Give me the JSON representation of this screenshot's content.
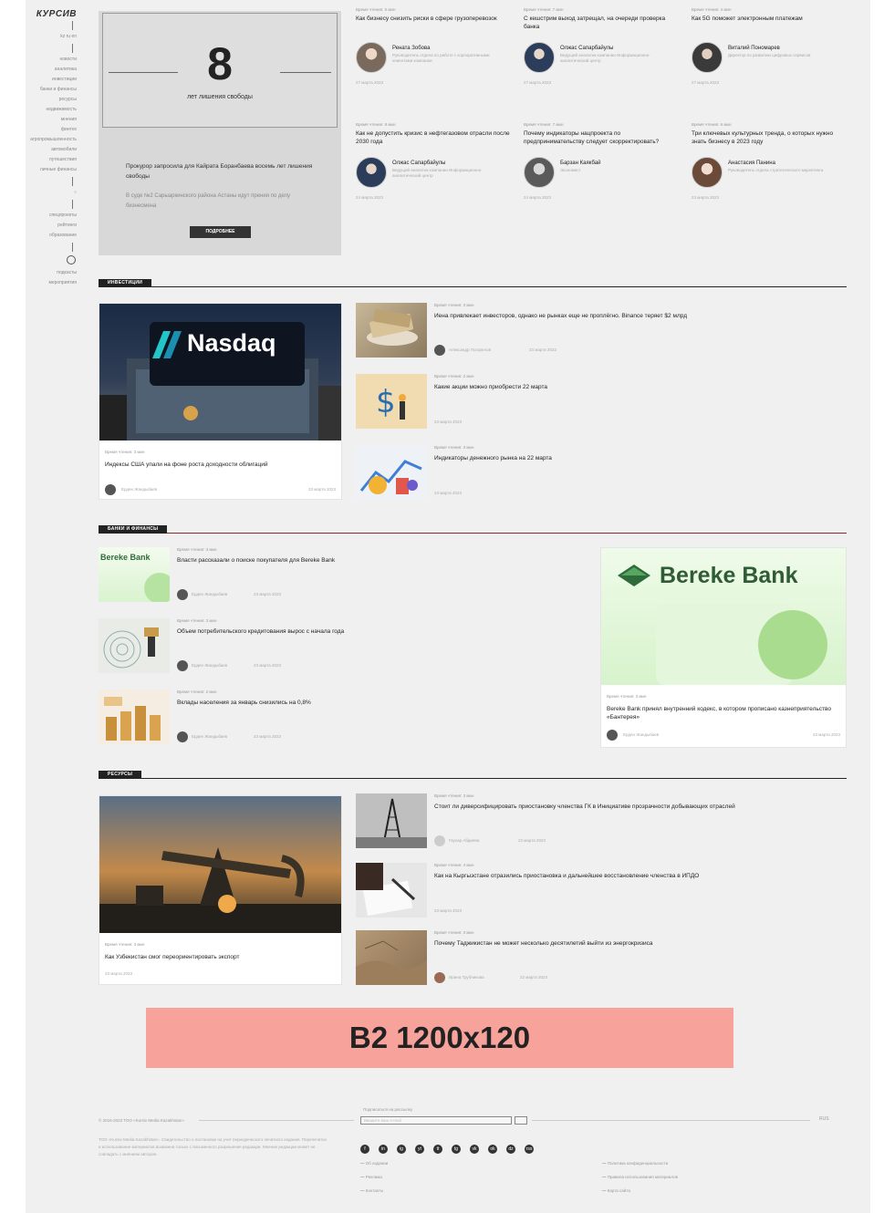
{
  "sidebar": {
    "logo": "КУРСИВ",
    "lang": "kz  ru  en",
    "items": [
      "новости",
      "аналитика",
      "инвестиции",
      "банки и финансы",
      "ресурсы",
      "недвижимость",
      "мнения",
      "финтех",
      "агропромышленность",
      "автомобили",
      "путешествия",
      "личные финансы"
    ],
    "items2": [
      "спецпроекты",
      "рейтинги",
      "образование"
    ],
    "items3": [
      "подкасты",
      "мероприятия"
    ]
  },
  "promo": {
    "number": "8",
    "caption": "лет лишения свободы",
    "headline": "Прокурор запросила для Кайрата Боранбаева восемь лет лишения свободы",
    "subtext": "В суде №2 Сарыаркинского района Астаны идут прения по делу бизнесмена",
    "button": "ПОДРОБНЕЕ"
  },
  "top_articles": [
    {
      "meta": "Время чтения: 5 мин",
      "title": "Как бизнесу снизить риски в сфере грузоперевозок",
      "author": "Рената Зобова",
      "bio": "Руководитель отдела по работе с корпоративными клиентами компании",
      "date": "27 марта 2023"
    },
    {
      "meta": "Время чтения: 7 мин",
      "title": "С кешстрим выход затрещал, на очереди проверка банка",
      "author": "Олжас Сапарбайулы",
      "bio": "Ведущий аналитик компании Информационно-аналитический центр",
      "date": "27 марта 2023"
    },
    {
      "meta": "Время чтения: 4 мин",
      "title": "Как 5G поможет электронным платежам",
      "author": "Виталий Пономарев",
      "bio": "Директор по развитию цифровых сервисов",
      "date": "27 марта 2023"
    },
    {
      "meta": "Время чтения: 8 мин",
      "title": "Как не допустить кризис в нефтегазовом отрасли после 2030 года",
      "author": "Олжас Сапарбайулы",
      "bio": "Ведущий аналитик компании Информационно-аналитический центр",
      "date": "24 марта 2023"
    },
    {
      "meta": "Время чтения: 7 мин",
      "title": "Почему индикаторы нацпроекта по предпринимательству следует скорректировать?",
      "author": "Барзан Каякбай",
      "bio": "Экономист",
      "date": "24 марта 2023"
    },
    {
      "meta": "Время чтения: 6 мин",
      "title": "Три ключевых культурных тренда, о которых нужно знать бизнесу в 2023 году",
      "author": "Анастасия Панина",
      "bio": "Руководитель отдела стратегического маркетинга",
      "date": "23 марта 2023"
    }
  ],
  "sections": {
    "investments": "ИНВЕСТИЦИИ",
    "banks": "БАНКИ И ФИНАНСЫ",
    "resources": "РЕСУРСЫ"
  },
  "investments": {
    "feature": {
      "image_text": "Nasdaq",
      "meta": "Время чтения: 3 мин",
      "title": "Индексы США упали на фоне роста доходности облигаций",
      "author": "Ерден Жандыбаев",
      "date": "23 марта 2023"
    },
    "list": [
      {
        "meta": "Время чтения: 3 мин",
        "title": "Иена привлекает инвесторов, однако не рынках еще не проплёгно. Binance теряет $2 млрд",
        "author": "Александр Погорелов",
        "date": "23 марта 2023"
      },
      {
        "meta": "Время чтения: 2 мин",
        "title": "Какие акции можно приобрести 22 марта",
        "author": "",
        "date": "23 марта 2023"
      },
      {
        "meta": "Время чтения: 3 мин",
        "title": "Индикаторы денежного рынка на 22 марта",
        "author": "",
        "date": "23 марта 2023"
      }
    ]
  },
  "banks": {
    "list": [
      {
        "thumb_text": "Bereke Bank",
        "meta": "Время чтения: 3 мин",
        "title": "Власти рассказали о поиске покупателя для Bereke Bank",
        "author": "Ерден Жандыбаев",
        "date": "23 марта 2023"
      },
      {
        "thumb_text": "",
        "meta": "Время чтения: 3 мин",
        "title": "Объем потребительского кредитования вырос с начала года",
        "author": "Ерден Жандыбаев",
        "date": "23 марта 2023"
      },
      {
        "thumb_text": "",
        "meta": "Время чтения: 2 мин",
        "title": "Вклады населения за январь снизились на 0,8%",
        "author": "Ерден Жандыбаев",
        "date": "22 марта 2023"
      }
    ],
    "feature": {
      "image_text": "Bereke Bank",
      "meta": "Время чтения: 3 мин",
      "title": "Bereke Bank принял внутренний кодекс, в котором прописано казнеприятельство «Бантерея»",
      "author": "Ерден Жандыбаев",
      "date": "23 марта 2023"
    }
  },
  "resources": {
    "feature": {
      "meta": "Время чтения: 3 мин",
      "title": "Как Узбекистан смог переориентировать экспорт",
      "date": "23 марта 2023"
    },
    "list": [
      {
        "meta": "Время чтения: 3 мин",
        "title": "Стоит ли диверсифицировать приостановку членства ГК в Инициативе прозрачности добывающих отраслей",
        "author": "Гаухар Абдиева",
        "date": "23 марта 2023"
      },
      {
        "meta": "Время чтения: 4 мин",
        "title": "Как на Кыргызстане отразились приостановка и дальнейшее восстановление членства в ИПДО",
        "author": "",
        "date": "23 марта 2023"
      },
      {
        "meta": "Время чтения: 3 мин",
        "title": "Почему Таджикистан не может несколько десятилетий выйти из энергокризиса",
        "author": "Ирина Трубникова",
        "date": "22 марта 2023"
      }
    ]
  },
  "banner": {
    "label": "B2 1200x120"
  },
  "footer": {
    "copyright": "© 2016-2023 ТОО «Kursiv Media Kazakhstan»",
    "subscribe_label": "Подписаться на рассылку",
    "subscribe_placeholder": "Введите ваш e-mail",
    "lang": "RUS",
    "desc": "ТОО «Kursiv Media Kazakhstan». Свидетельство о постановке на учет периодического печатного издания. Перепечатка и использование материалов возможна только с письменного разрешения редакции. Мнение редакции может не совпадать с мнением авторов.",
    "socials": [
      "f",
      "in",
      "ig",
      "yt",
      "tt",
      "tg",
      "vk",
      "ok",
      "dz",
      "rss"
    ],
    "links_left": [
      "Об издании",
      "Реклама",
      "Контакты"
    ],
    "links_right": [
      "Политика конфиденциальности",
      "Правила использования материалов",
      "Карта сайта"
    ]
  }
}
